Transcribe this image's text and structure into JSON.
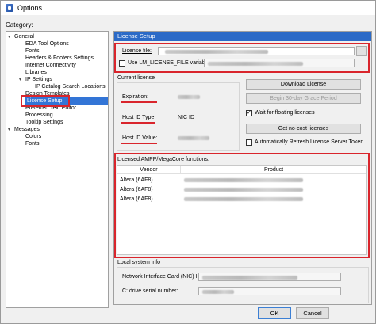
{
  "window": {
    "title": "Options"
  },
  "category_label": "Category:",
  "tree": [
    {
      "label": "General",
      "arrow": "▾"
    },
    {
      "label": "EDA Tool Options"
    },
    {
      "label": "Fonts"
    },
    {
      "label": "Headers & Footers Settings"
    },
    {
      "label": "Internet Connectivity"
    },
    {
      "label": "Libraries"
    },
    {
      "label": "IP Settings",
      "arrow": "▾"
    },
    {
      "label": "IP Catalog Search Locations"
    },
    {
      "label": "Design Templates"
    },
    {
      "label": "License Setup",
      "selected": true
    },
    {
      "label": "Preferred Text Editor"
    },
    {
      "label": "Processing"
    },
    {
      "label": "Tooltip Settings"
    },
    {
      "label": "Messages",
      "arrow": "▾"
    },
    {
      "label": "Colors"
    },
    {
      "label": "Fonts"
    }
  ],
  "panel": {
    "header": "License Setup",
    "license_file_label": "License file:",
    "browse_label": "...",
    "use_env_label": "Use LM_LICENSE_FILE variable:",
    "current_license_title": "Current license",
    "expiration_label": "Expiration:",
    "host_id_type_label": "Host ID Type:",
    "host_id_type_value": "NIC ID",
    "host_id_value_label": "Host ID Value:",
    "download_license_label": "Download License",
    "grace_period_label": "Begin 30-day Grace Period",
    "wait_floating_label": "Wait for floating licenses",
    "wait_floating_checked": "✓",
    "no_cost_label": "Get no-cost licenses",
    "auto_refresh_label": "Automatically Refresh License Server Token",
    "licensed_functions_title": "Licensed AMPP/MegaCore functions:",
    "table_headers": [
      "Vendor",
      "Product"
    ],
    "table_rows": [
      {
        "vendor": "Altera (6AF8)"
      },
      {
        "vendor": "Altera (6AF8)"
      },
      {
        "vendor": "Altera (6AF8)"
      }
    ],
    "local_system_title": "Local system info",
    "nic_label": "Network Interface Card (NIC) ID:",
    "drive_label": "C: drive serial number:"
  },
  "footer": {
    "ok": "OK",
    "cancel": "Cancel"
  },
  "colors": {
    "accent": "#2b6ac7",
    "highlight": "#d9252c"
  }
}
